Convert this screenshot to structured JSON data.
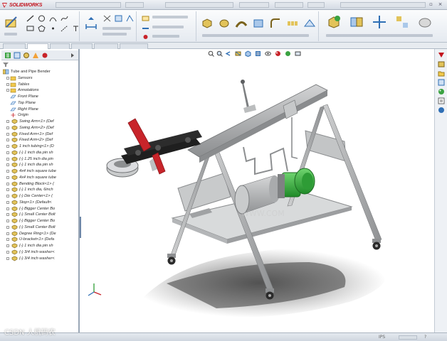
{
  "app": {
    "brand": "SOLIDWORKS",
    "watermark": "CSDN 人机码农",
    "watermark_center": "WWW.COM"
  },
  "feature_tree": {
    "root": "Tube and Pipe Bender",
    "items": [
      {
        "label": "Sensors",
        "icon": "sensor-icon",
        "kind": "folder"
      },
      {
        "label": "Tables",
        "icon": "table-icon",
        "kind": "folder"
      },
      {
        "label": "Annotations",
        "icon": "annotation-icon",
        "kind": "folder"
      },
      {
        "label": "Front Plane",
        "icon": "plane-icon",
        "kind": "plane"
      },
      {
        "label": "Top Plane",
        "icon": "plane-icon",
        "kind": "plane"
      },
      {
        "label": "Right Plane",
        "icon": "plane-icon",
        "kind": "plane"
      },
      {
        "label": "Origin",
        "icon": "origin-icon",
        "kind": "origin"
      },
      {
        "label": "Swing Arm<1> (Def",
        "icon": "part-icon",
        "kind": "part"
      },
      {
        "label": "Swing Arm<2> (Def",
        "icon": "part-icon",
        "kind": "part"
      },
      {
        "label": "Fixed Arm<1> (Def",
        "icon": "part-icon",
        "kind": "part"
      },
      {
        "label": "Fixed Arm<2> (Def",
        "icon": "part-icon",
        "kind": "part"
      },
      {
        "label": "1 inch tubing<1> (D",
        "icon": "part-icon",
        "kind": "part"
      },
      {
        "label": "(-) 1 inch dia pin sh",
        "icon": "part-icon",
        "kind": "part"
      },
      {
        "label": "(-) 1.25 inch dia pin",
        "icon": "part-icon",
        "kind": "part"
      },
      {
        "label": "(-) 1 inch dia pin sh",
        "icon": "part-icon",
        "kind": "part"
      },
      {
        "label": "4x4 inch square tube",
        "icon": "part-icon",
        "kind": "part"
      },
      {
        "label": "4x4 inch square tube",
        "icon": "part-icon",
        "kind": "part"
      },
      {
        "label": "Bending Block<1> (",
        "icon": "part-icon",
        "kind": "part"
      },
      {
        "label": "(-) 1 inch dia, 6inch",
        "icon": "part-icon",
        "kind": "part"
      },
      {
        "label": "(-) Die Center<1> (",
        "icon": "part-icon",
        "kind": "part"
      },
      {
        "label": "Stop<1> (Default<",
        "icon": "part-icon",
        "kind": "part"
      },
      {
        "label": "(-) Bigger Center Bo",
        "icon": "part-icon",
        "kind": "part"
      },
      {
        "label": "(-) Small Center Bolt",
        "icon": "part-icon",
        "kind": "part"
      },
      {
        "label": "(-) Bigger Center Bo",
        "icon": "part-icon",
        "kind": "part"
      },
      {
        "label": "(-) Small Center Bolt",
        "icon": "part-icon",
        "kind": "part"
      },
      {
        "label": "Degree Ring<1> (De",
        "icon": "part-icon",
        "kind": "part"
      },
      {
        "label": "U-bracket<1> (Defa",
        "icon": "part-icon",
        "kind": "part"
      },
      {
        "label": "(-) 1 inch dia pin sh",
        "icon": "part-icon",
        "kind": "part"
      },
      {
        "label": "(-) 3/4 inch washer<",
        "icon": "part-icon",
        "kind": "part"
      },
      {
        "label": "(-) 3/4 inch washer<",
        "icon": "part-icon",
        "kind": "part"
      }
    ]
  },
  "colors": {
    "accent_red": "#c3121c",
    "motor_green": "#2fae38",
    "frame_gray": "#a7a9ab",
    "handle_red": "#c8242a",
    "toolbar_blue": "#2f6fb5"
  },
  "status": {
    "units": "IPS",
    "help": "?"
  }
}
